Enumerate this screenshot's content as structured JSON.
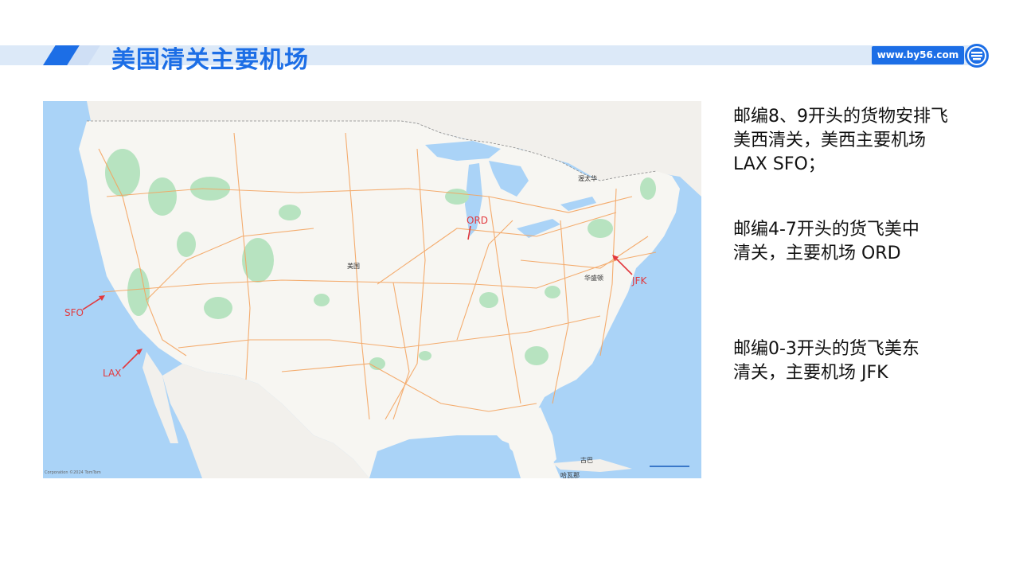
{
  "header": {
    "title": "美国清关主要机场",
    "url": "www.by56.com",
    "accent_color": "#1c6ee6",
    "bar_color": "#dce9f8"
  },
  "map": {
    "country_label": "美国",
    "cities": {
      "chicago_area": "",
      "toronto": "渥太华",
      "washington": "华盛顿",
      "havana": "哈瓦那",
      "cuba": "古巴"
    },
    "airports": [
      {
        "code": "SFO"
      },
      {
        "code": "LAX"
      },
      {
        "code": "ORD"
      },
      {
        "code": "JFK"
      }
    ],
    "credit": "Corporation  ©2024 TomTom"
  },
  "notes": [
    {
      "lines": [
        "邮编8、9开头的货物安排飞",
        "美西清关，美西主要机场",
        "LAX SFO；"
      ]
    },
    {
      "lines": [
        "邮编4-7开头的货飞美中",
        "清关，主要机场 ORD"
      ]
    },
    {
      "lines": [
        "邮编0-3开头的货飞美东",
        "清关，主要机场 JFK"
      ]
    }
  ]
}
